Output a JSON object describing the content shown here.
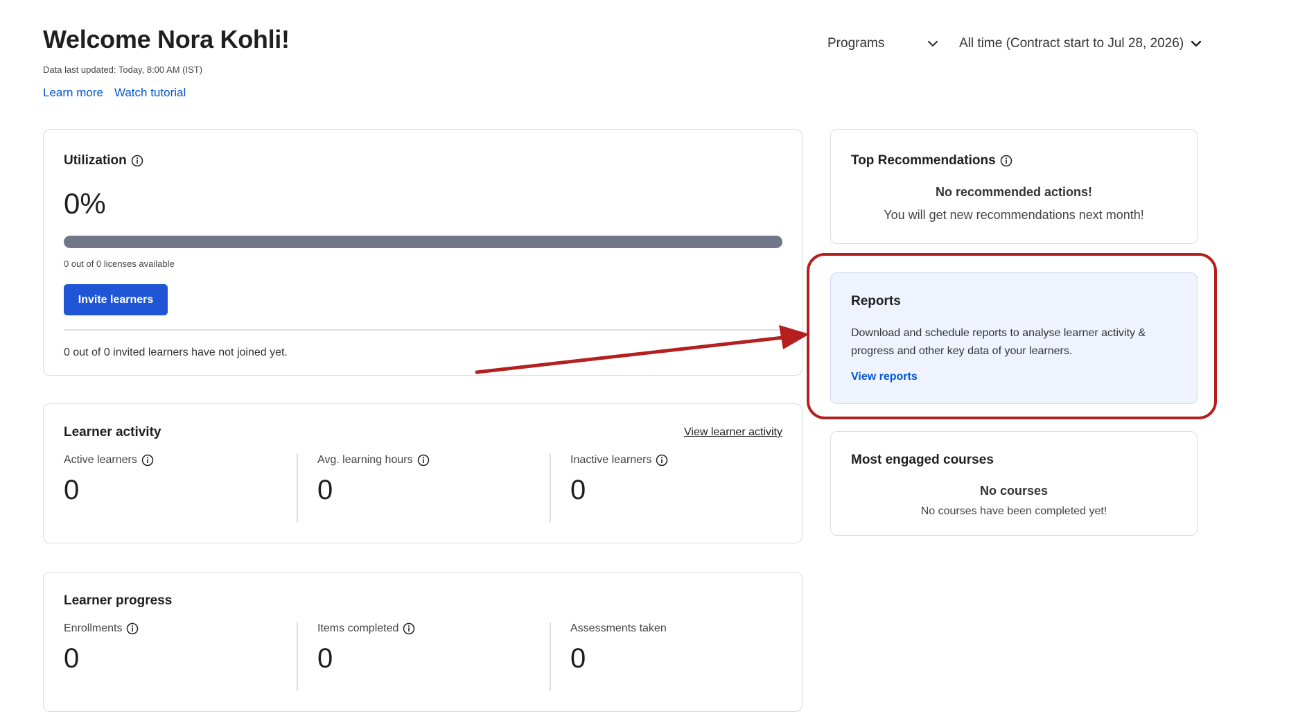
{
  "header": {
    "title": "Welcome Nora Kohli!",
    "updated": "Data last updated: Today, 8:00 AM (IST)",
    "learn_more": "Learn more",
    "watch_tutorial": "Watch tutorial"
  },
  "filters": {
    "programs": "Programs",
    "time_range": "All time (Contract start to Jul 28, 2026)"
  },
  "utilization": {
    "title": "Utilization",
    "percent": "0%",
    "licenses": "0 out of 0 licenses available",
    "invite_button": "Invite learners",
    "invited_note": "0 out of 0 invited learners have not joined yet."
  },
  "learner_activity": {
    "title": "Learner activity",
    "view_link": "View learner activity",
    "metrics": [
      {
        "label": "Active learners",
        "value": "0"
      },
      {
        "label": "Avg. learning hours",
        "value": "0"
      },
      {
        "label": "Inactive learners",
        "value": "0"
      }
    ]
  },
  "learner_progress": {
    "title": "Learner progress",
    "metrics": [
      {
        "label": "Enrollments",
        "value": "0"
      },
      {
        "label": "Items completed",
        "value": "0"
      },
      {
        "label": "Assessments taken",
        "value": "0"
      }
    ]
  },
  "recommendations": {
    "title": "Top Recommendations",
    "heading": "No recommended actions!",
    "subtext": "You will get new recommendations next month!"
  },
  "reports": {
    "title": "Reports",
    "description": "Download and schedule reports to analyse learner activity & progress and other key data of your learners.",
    "link": "View reports"
  },
  "courses": {
    "title": "Most engaged courses",
    "heading": "No courses",
    "subtext": "No courses have been completed yet!"
  },
  "annotation": {
    "highlight_color": "#b4201d"
  },
  "colors": {
    "primary": "#1f56d6",
    "link": "#0056d2",
    "reports_bg": "#eef3fd"
  }
}
